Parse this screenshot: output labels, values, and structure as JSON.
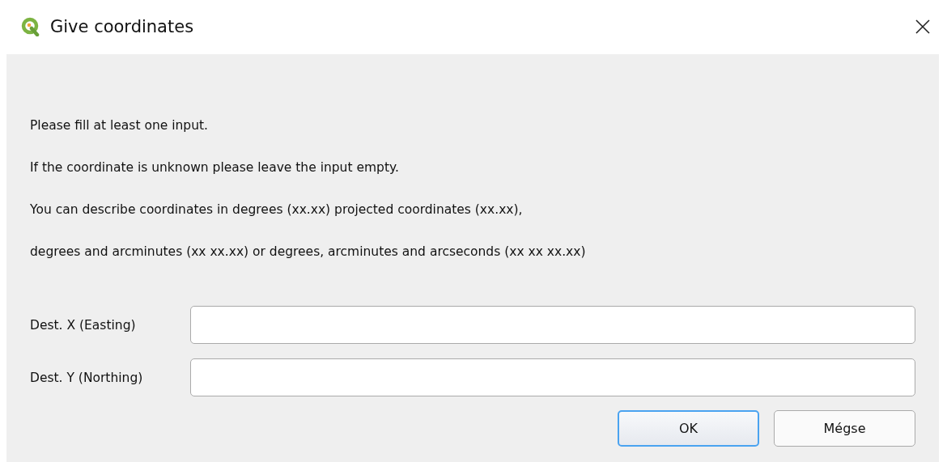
{
  "window": {
    "title": "Give coordinates"
  },
  "messages": [
    "Please fill at least one input.",
    "If the coordinate is unknown please leave the input empty.",
    "You can describe coordinates in degrees (xx.xx) projected coordinates (xx.xx),",
    "degrees and arcminutes (xx xx.xx) or degrees, arcminutes and arcseconds (xx xx xx.xx)"
  ],
  "fields": [
    {
      "label": "Dest. X (Easting)"
    },
    {
      "label": "Dest. Y (Northing)"
    }
  ],
  "buttons": [
    {
      "label": "OK",
      "default": true
    },
    {
      "label": "Mégse",
      "default": false
    }
  ]
}
